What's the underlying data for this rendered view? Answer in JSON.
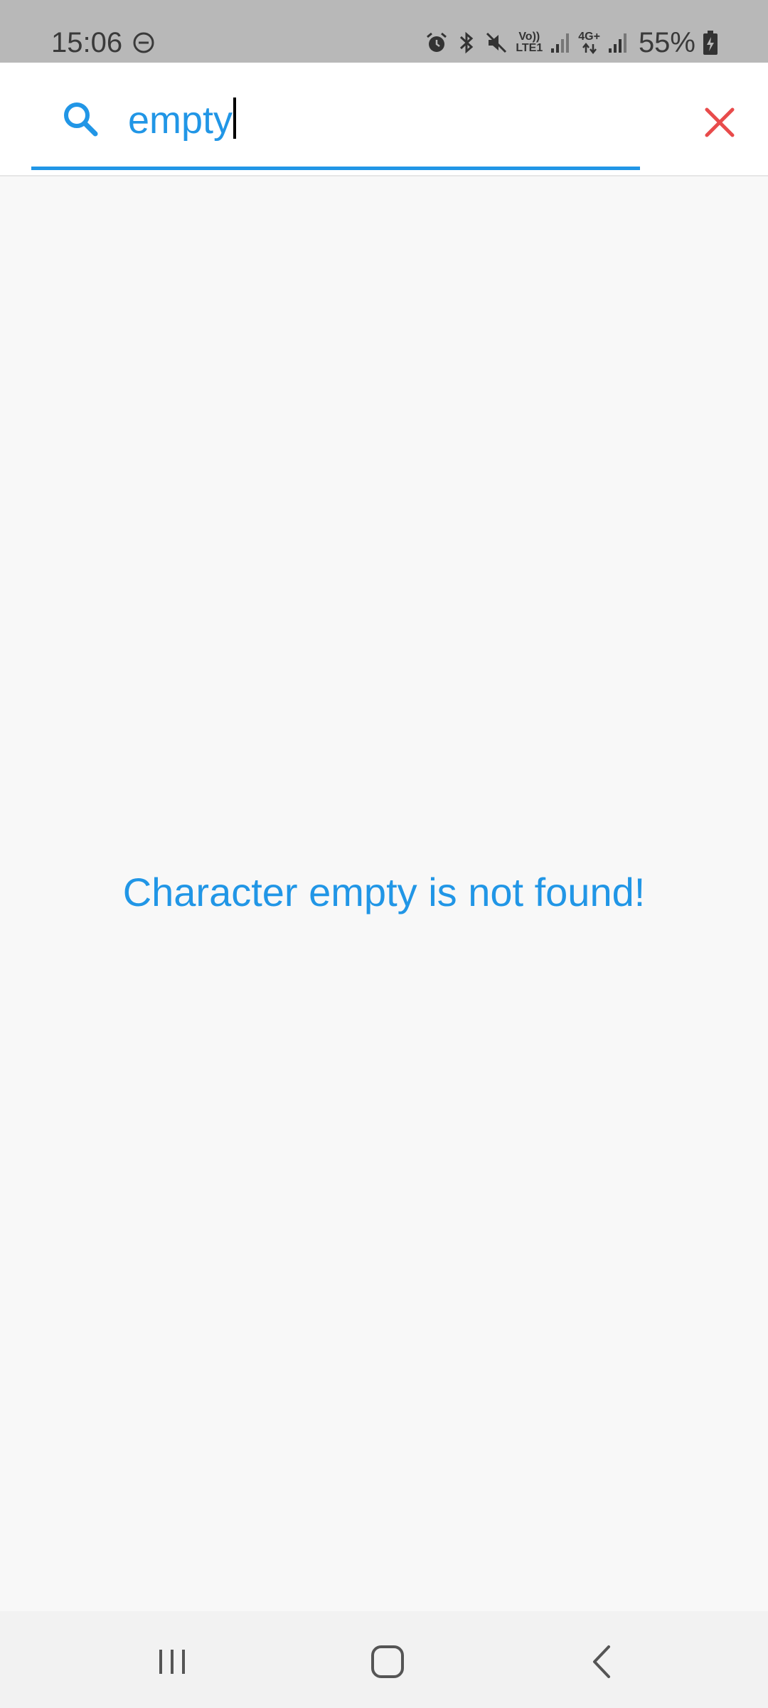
{
  "status_bar": {
    "time": "15:06",
    "network_top": "Vo))",
    "network_bottom": "LTE1",
    "network2": "4G+",
    "battery": "55%"
  },
  "search": {
    "query": "empty",
    "icon": "search-icon",
    "clear_icon": "close-icon"
  },
  "main": {
    "empty_message": "Character empty is not found!"
  },
  "nav": {
    "recents_icon": "recents-icon",
    "home_icon": "home-icon",
    "back_icon": "back-icon"
  },
  "colors": {
    "accent": "#2196e6",
    "clear": "#e84b4b",
    "status_bar_bg": "#b8b8b8",
    "background": "#f8f8f8"
  }
}
